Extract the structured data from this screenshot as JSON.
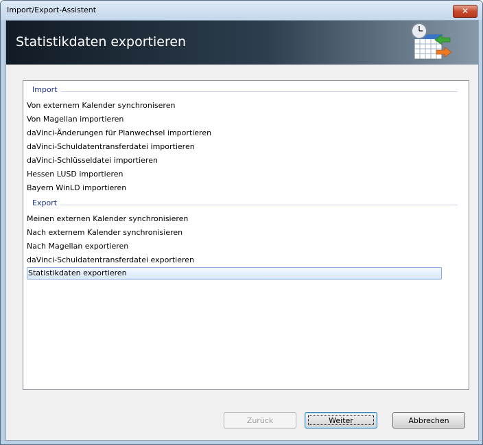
{
  "window": {
    "title": "Import/Export-Assistent",
    "close_glyph": "✕"
  },
  "banner": {
    "title": "Statistikdaten exportieren",
    "icon": "calendar-sync-icon"
  },
  "groups": [
    {
      "label": "Import",
      "items": [
        "Von externem Kalender synchroniseren",
        "Von Magellan importieren",
        "daVinci-Änderungen für Planwechsel importieren",
        "daVinci-Schuldatentransferdatei importieren",
        "daVinci-Schlüsseldatei importieren",
        "Hessen LUSD importieren",
        "Bayern WinLD importieren"
      ]
    },
    {
      "label": "Export",
      "items": [
        "Meinen externen Kalender synchronisieren",
        "Nach externem Kalender synchronisieren",
        "Nach Magellan exportieren",
        "daVinci-Schuldatentransferdatei exportieren",
        "Statistikdaten exportieren"
      ]
    }
  ],
  "selected_item": "Statistikdaten exportieren",
  "buttons": {
    "back": "Zurück",
    "next": "Weiter",
    "cancel": "Abbrechen"
  },
  "colors": {
    "group_header": "#1e3287",
    "selection_border": "#84acdd",
    "banner_dark": "#111b25"
  }
}
